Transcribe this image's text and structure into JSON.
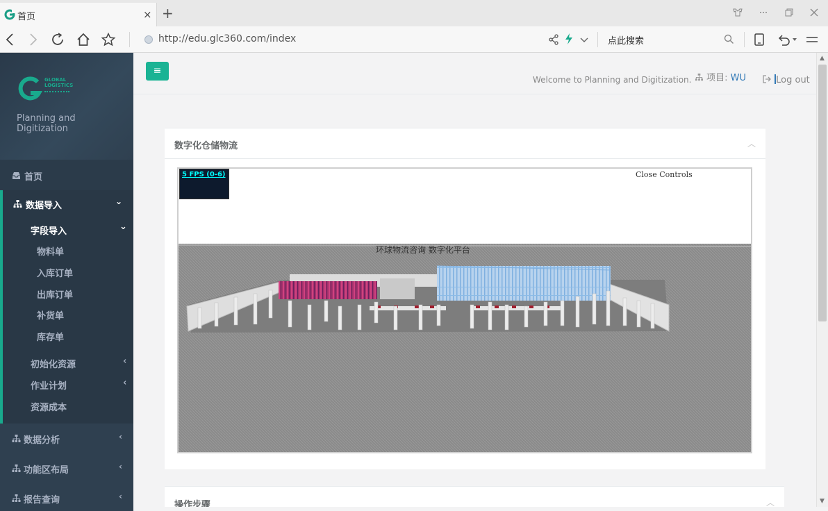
{
  "browser": {
    "tab_title": "首页",
    "tab_close": "×",
    "new_tab": "+",
    "url": "http://edu.glc360.com/index",
    "search_placeholder": "点此搜索"
  },
  "sidebar": {
    "brand_name_line1": "GLOBAL",
    "brand_name_line2": "LOGISTICS",
    "tagline": "Planning and Digitization",
    "items": [
      {
        "label": "首页"
      },
      {
        "label": "数据导入",
        "expanded": true
      },
      {
        "label": "数据分析"
      },
      {
        "label": "功能区布局"
      },
      {
        "label": "报告查询"
      }
    ],
    "import_sub": {
      "field_import": "字段导入",
      "field_items": [
        "物料单",
        "入库订单",
        "出库订单",
        "补货单",
        "库存单"
      ],
      "others": [
        "初始化资源",
        "作业计划",
        "资源成本"
      ]
    },
    "chevron_down": "⌄",
    "chevron_left": "‹"
  },
  "topbar": {
    "menu_icon": "≡",
    "welcome": "Welcome to Planning and Digitization.",
    "project_label": "项目:",
    "project_value": "WU",
    "logout": "Log out"
  },
  "card1": {
    "title": "数字化仓储物流",
    "viewer": {
      "fps": "5 FPS (0-6)",
      "close_controls": "Close Controls",
      "scene_caption": "环球物流咨询 数字化平台"
    }
  },
  "card2": {
    "title": "操作步骤"
  },
  "colors": {
    "sidebar_bg": "#2f4050",
    "accent": "#1ab394",
    "link": "#337ab7"
  }
}
